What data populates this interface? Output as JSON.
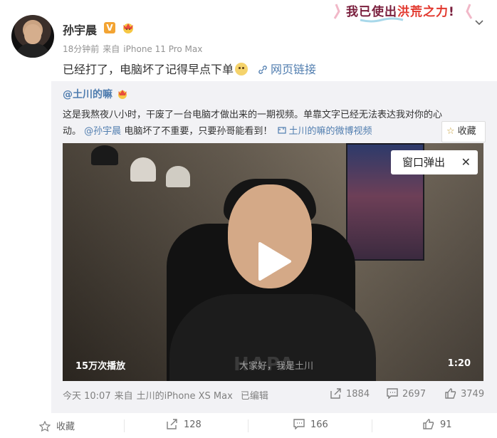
{
  "post": {
    "author": "孙宇晨",
    "time": "18分钟前",
    "from_label": "来自",
    "device": "iPhone 11 Pro Max",
    "text": "已经打了，电脑坏了记得早点下单",
    "web_link": "网页链接"
  },
  "banner": {
    "text_a": "我已使出",
    "text_b": "洪荒之力",
    "text_c": "!"
  },
  "repost": {
    "author": "@土川的嘛",
    "text_line1": "这是我熬夜八小时，干废了一台电脑才做出来的一期视频。单靠文字已经无法表达我对你的心",
    "text_line2_a": "动。",
    "mention": "@孙宇晨",
    "text_line2_b": "电脑坏了不重要，只要孙哥能看到！",
    "video_link": "土川的嘛的微博视频",
    "collect_label": "收藏",
    "video": {
      "popout_label": "窗口弹出",
      "close_glyph": "✕",
      "plays": "15万次播放",
      "duration": "1:20",
      "subtitle": "大家好，我是土川",
      "shirt_text": "HAPA"
    },
    "meta": {
      "time": "今天 10:07",
      "from_label": "来自",
      "source": "土川的iPhone XS Max",
      "edited": "已编辑"
    },
    "stats": {
      "reposts": "1884",
      "comments": "2697",
      "likes": "3749"
    }
  },
  "actions": {
    "collect": "收藏",
    "repost": "128",
    "comment": "166",
    "like": "91"
  },
  "colors": {
    "link": "#507daf",
    "repost_bg": "#f2f2f5",
    "vip": "#f3a433"
  }
}
